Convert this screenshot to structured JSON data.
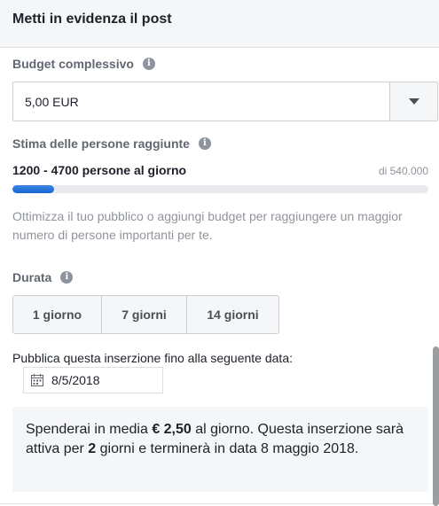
{
  "header": {
    "title": "Metti in evidenza il post"
  },
  "budget": {
    "label": "Budget complessivo",
    "info_icon": "info-icon",
    "value": "5,00 EUR",
    "dropdown_icon": "caret-down-icon"
  },
  "reach": {
    "label": "Stima delle persone raggiunte",
    "range": "1200 - 4700 persone al giorno",
    "total": "di 540.000",
    "progress_fraction": 0.1,
    "progress_color": "#1a66d4",
    "hint": "Ottimizza il tuo pubblico o aggiungi budget per raggiungere un maggior numero di persone importanti per te."
  },
  "duration": {
    "label": "Durata",
    "options": [
      "1 giorno",
      "7 giorni",
      "14 giorni"
    ]
  },
  "schedule": {
    "label": "Pubblica questa inserzione fino alla seguente data:",
    "date": "8/5/2018",
    "calendar_icon": "calendar-icon"
  },
  "summary": {
    "part1": "Spenderai in media ",
    "amount": "€ 2,50",
    "part2": " al giorno. Questa inserzione sarà attiva per ",
    "days": "2",
    "part3": " giorni e terminerà in data 8 maggio 2018."
  }
}
